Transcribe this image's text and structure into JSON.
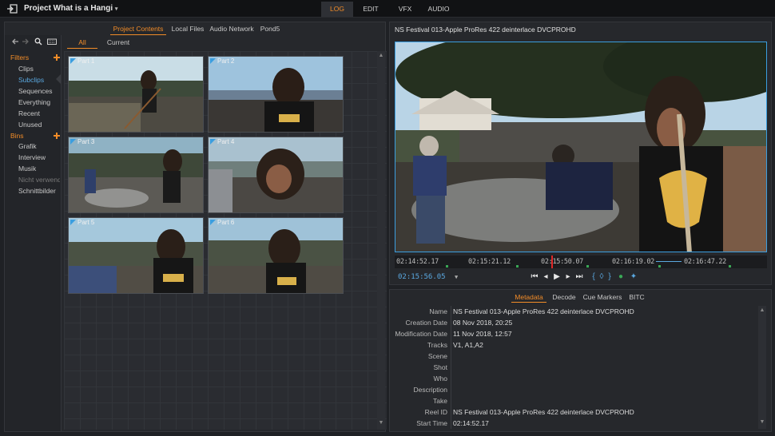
{
  "app": {
    "project_title": "Project What is a Hangi",
    "modes": [
      "LOG",
      "EDIT",
      "VFX",
      "AUDIO"
    ],
    "active_mode": "LOG"
  },
  "left_panel": {
    "tabs": [
      "Project Contents",
      "Local Files",
      "Audio Network",
      "Pond5"
    ],
    "active_tab": "Project Contents",
    "sidebar": {
      "filters_label": "Filters",
      "filters": [
        "Clips",
        "Subclips",
        "Sequences",
        "Everything",
        "Recent",
        "Unused"
      ],
      "active_filter": "Subclips",
      "bins_label": "Bins",
      "bins": [
        "Grafik",
        "Interview",
        "Musik",
        "Nicht verwende",
        "Schnittbilder"
      ]
    },
    "content_tabs": [
      "All",
      "Current"
    ],
    "active_content_tab": "All",
    "thumbnails": [
      "Part 1",
      "Part 2",
      "Part 3",
      "Part 4",
      "Part 5",
      "Part 6"
    ]
  },
  "viewer": {
    "clip_title": "NS Festival 013-Apple ProRes 422 deinterlace DVCPROHD",
    "timeline_timecodes": [
      "02:14:52.17",
      "02:15:21.12",
      "02:15:50.07",
      "02:16:19.02",
      "02:16:47.22"
    ],
    "current_timecode": "02:15:56.05",
    "playhead_position": 0.42
  },
  "metadata": {
    "tabs": [
      "Metadata",
      "Decode",
      "Cue Markers",
      "BITC"
    ],
    "active_tab": "Metadata",
    "rows": [
      {
        "key": "Name",
        "value": "NS Festival 013-Apple ProRes 422 deinterlace DVCPROHD"
      },
      {
        "key": "Creation Date",
        "value": "08 Nov 2018, 20:25"
      },
      {
        "key": "Modification Date",
        "value": "11 Nov 2018, 12:57"
      },
      {
        "key": "Tracks",
        "value": "V1, A1,A2"
      },
      {
        "key": "Scene",
        "value": ""
      },
      {
        "key": "Shot",
        "value": ""
      },
      {
        "key": "Who",
        "value": ""
      },
      {
        "key": "Description",
        "value": ""
      },
      {
        "key": "Take",
        "value": ""
      },
      {
        "key": "Reel ID",
        "value": "NS Festival 013-Apple ProRes 422 deinterlace DVCPROHD"
      },
      {
        "key": "Start Time",
        "value": "02:14:52.17"
      }
    ]
  },
  "colors": {
    "accent": "#f28c28",
    "selection": "#3a9ee0",
    "playhead": "#e02828"
  }
}
